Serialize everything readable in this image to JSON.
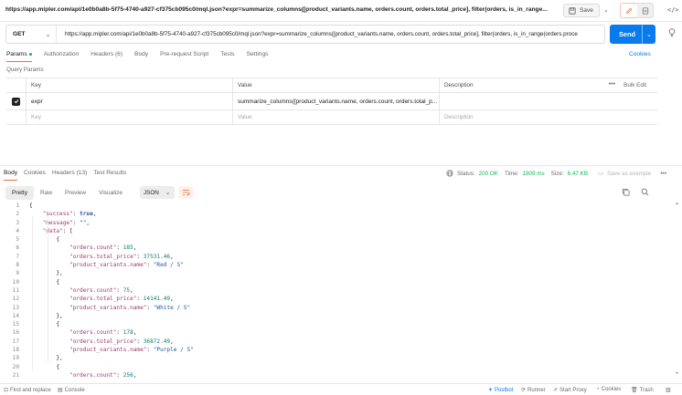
{
  "title_bar": {
    "request_title": "https://app.mipler.com/api/1e0b0a8b-5f75-4740-a927-cf375cb095c0/mql.json?expr=summarize_columns([product_variants.name, orders.count, orders.total_price], filter(orders, is_in_range...",
    "save_label": "Save"
  },
  "url_bar": {
    "method": "GET",
    "url": "https://app.mipler.com/api/1e0b0a8b-5f75-4740-a927-cf375cb095c0/mql.json?expr=summarize_columns([product_variants.name, orders.count, orders.total_price], filter(orders, is_in_range(orders.proce",
    "send_label": "Send"
  },
  "request_tabs": [
    {
      "label": "Params"
    },
    {
      "label": "Authorization"
    },
    {
      "label": "Headers (6)"
    },
    {
      "label": "Body"
    },
    {
      "label": "Pre-request Script"
    },
    {
      "label": "Tests"
    },
    {
      "label": "Settings"
    }
  ],
  "cookies_label": "Cookies",
  "query_params": {
    "section_label": "Query Params",
    "headers": {
      "key": "Key",
      "value": "Value",
      "description": "Description",
      "bulk_edit": "Bulk Edit"
    },
    "rows": [
      {
        "key": "expr",
        "value": "summarize_columns([product_variants.name, orders.count, orders.total_p...",
        "description": ""
      }
    ],
    "placeholder": {
      "key": "Key",
      "value": "Value",
      "description": "Description"
    }
  },
  "response": {
    "tabs": [
      {
        "label": "Body"
      },
      {
        "label": "Cookies"
      },
      {
        "label": "Headers (13)"
      },
      {
        "label": "Test Results"
      }
    ],
    "status_label": "Status:",
    "status_value": "200 OK",
    "time_label": "Time:",
    "time_value": "1909 ms",
    "size_label": "Size:",
    "size_value": "6.47 KB",
    "save_example": "Save as example",
    "format_tabs": [
      {
        "label": "Pretty"
      },
      {
        "label": "Raw"
      },
      {
        "label": "Preview"
      },
      {
        "label": "Visualize"
      }
    ],
    "format_select": "JSON",
    "lines": [
      {
        "n": "1",
        "t": "{"
      },
      {
        "n": "2",
        "t": "    \"success\": true,"
      },
      {
        "n": "3",
        "t": "    \"message\": \"\","
      },
      {
        "n": "4",
        "t": "    \"data\": ["
      },
      {
        "n": "5",
        "t": "        {"
      },
      {
        "n": "6",
        "t": "            \"orders.count\": 185,"
      },
      {
        "n": "7",
        "t": "            \"orders.total_price\": 37531.46,"
      },
      {
        "n": "8",
        "t": "            \"product_variants.name\": \"Red / S\""
      },
      {
        "n": "9",
        "t": "        },"
      },
      {
        "n": "10",
        "t": "        {"
      },
      {
        "n": "11",
        "t": "            \"orders.count\": 75,"
      },
      {
        "n": "12",
        "t": "            \"orders.total_price\": 14141.49,"
      },
      {
        "n": "13",
        "t": "            \"product_variants.name\": \"White / S\""
      },
      {
        "n": "14",
        "t": "        },"
      },
      {
        "n": "15",
        "t": "        {"
      },
      {
        "n": "16",
        "t": "            \"orders.count\": 178,"
      },
      {
        "n": "17",
        "t": "            \"orders.total_price\": 36872.49,"
      },
      {
        "n": "18",
        "t": "            \"product_variants.name\": \"Purple / S\""
      },
      {
        "n": "19",
        "t": "        },"
      },
      {
        "n": "20",
        "t": "        {"
      },
      {
        "n": "21",
        "t": "            \"orders.count\": 256,"
      }
    ]
  },
  "footer": {
    "find_replace": "Find and replace",
    "console": "Console",
    "postbot": "Postbot",
    "runner": "Runner",
    "start_proxy": "Start Proxy",
    "cookies": "Cookies",
    "trash": "Trash"
  },
  "colors": {
    "accent": "#097bed",
    "status_ok": "#0cbb52",
    "active_tab_underline": "#f26b3a"
  }
}
